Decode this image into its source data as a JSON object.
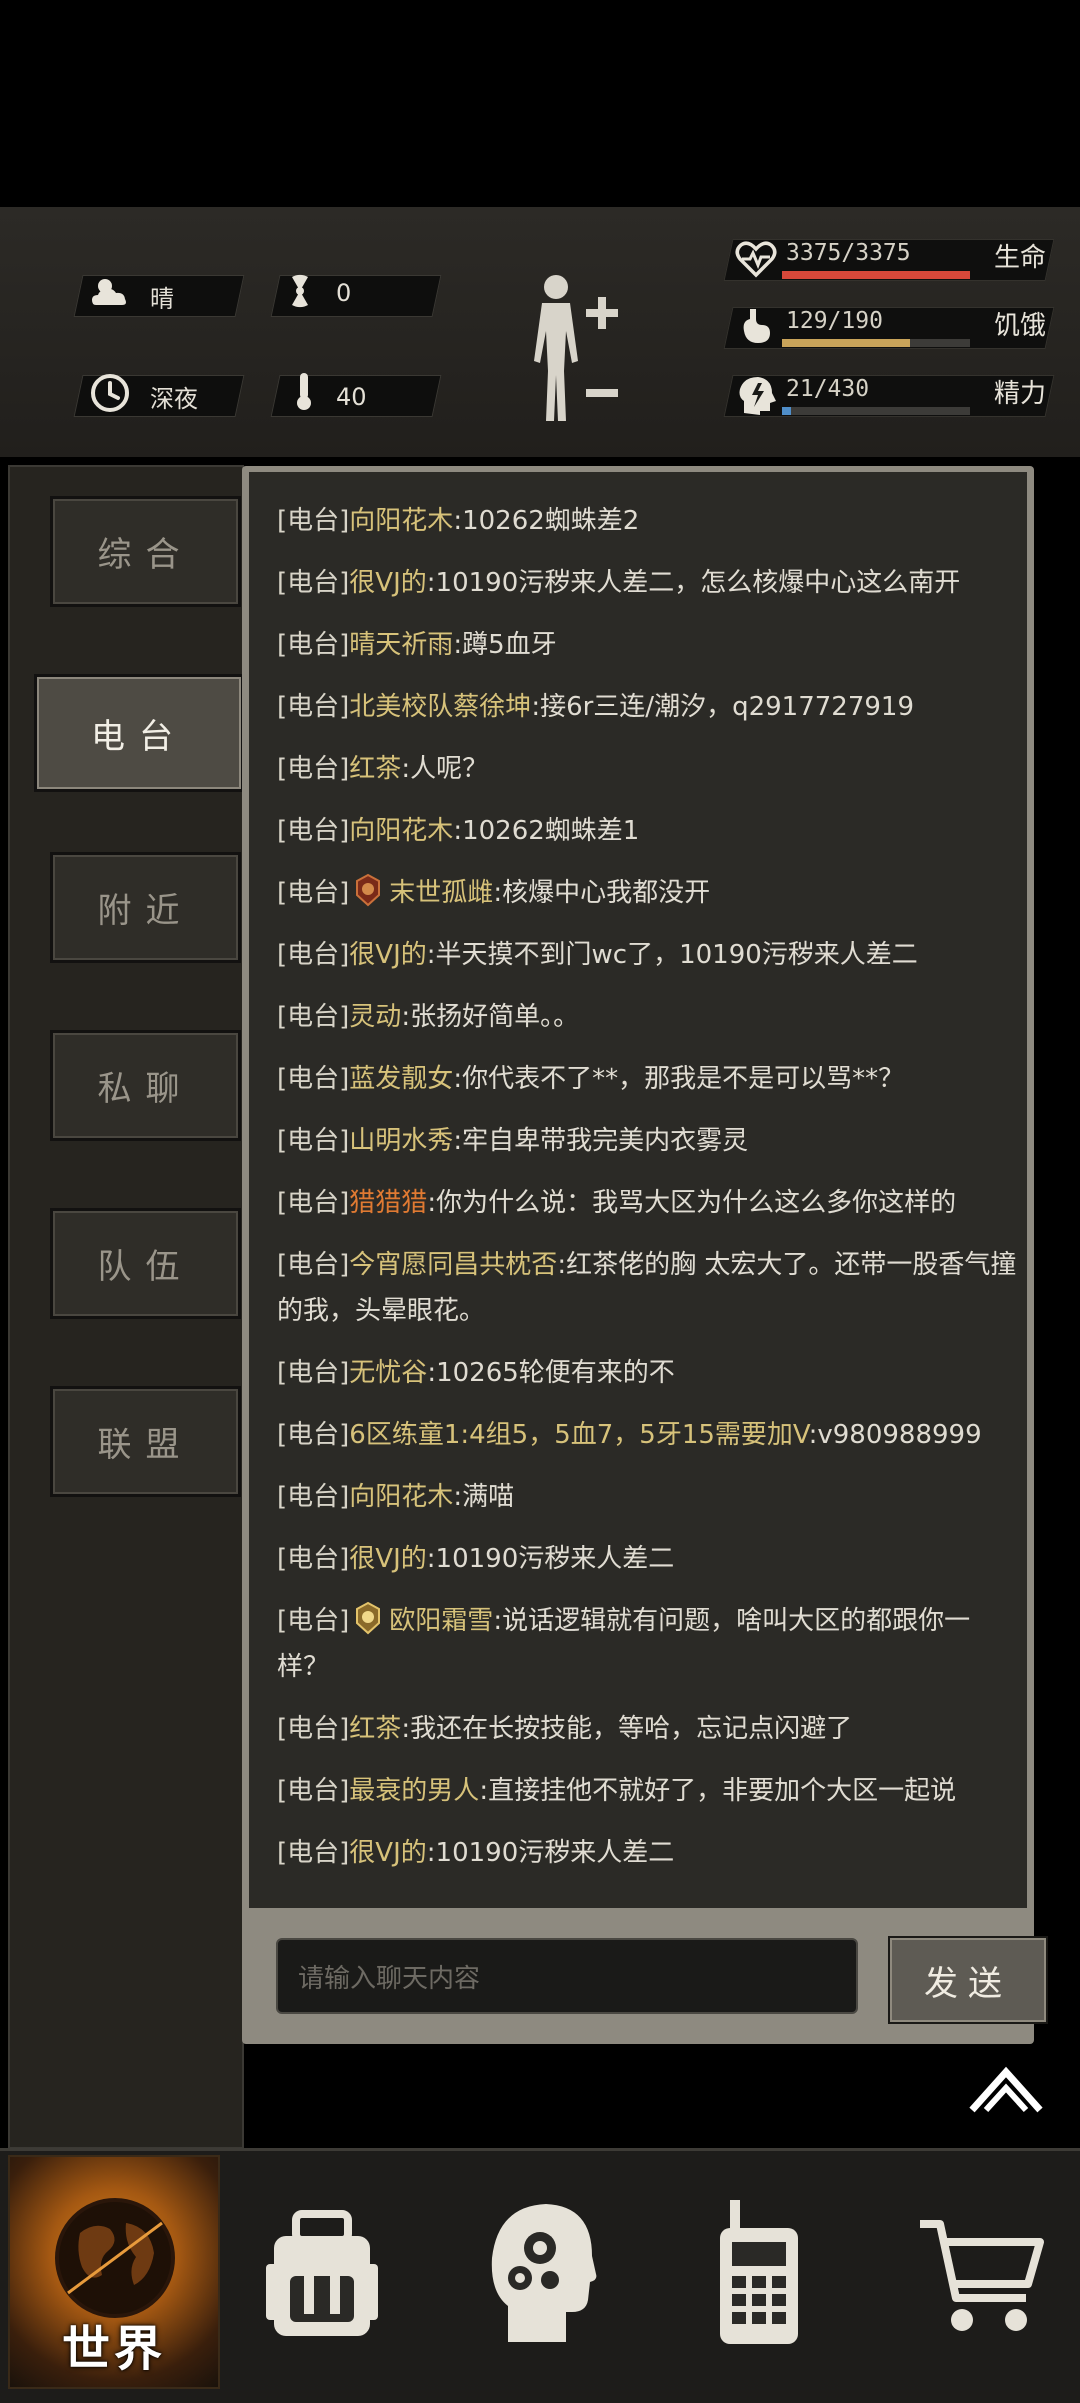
{
  "status": {
    "weather": "晴",
    "radiation": "0",
    "time_of_day": "深夜",
    "temperature": "40",
    "health": {
      "text": "3375/3375",
      "label": "生命",
      "fill": 1.0,
      "color": "#d9483a"
    },
    "hunger": {
      "text": "129/190",
      "label": "饥饿",
      "fill": 0.68,
      "color": "#c9a45a"
    },
    "energy": {
      "text": "21/430",
      "label": "精力",
      "fill": 0.05,
      "color": "#4f8ec9"
    }
  },
  "tabs": [
    {
      "label": "综合",
      "active": false
    },
    {
      "label": "电台",
      "active": true
    },
    {
      "label": "附近",
      "active": false
    },
    {
      "label": "私聊",
      "active": false
    },
    {
      "label": "队伍",
      "active": false
    },
    {
      "label": "联盟",
      "active": false
    }
  ],
  "chat": {
    "messages": [
      {
        "channel": "[电台]",
        "nick": "向阳花木",
        "text": ":10262蜘蛛差2"
      },
      {
        "channel": "[电台]",
        "nick": "很VJ的",
        "text": ":10190污秽来人差二，怎么核爆中心这么南开"
      },
      {
        "channel": "[电台]",
        "nick": "晴天祈雨",
        "text": ":蹲5血牙"
      },
      {
        "channel": "[电台]",
        "nick": "北美校队蔡徐坤",
        "text": ":接6r三连/潮汐，q2917727919"
      },
      {
        "channel": "[电台]",
        "nick": "红茶",
        "text": ":人呢？"
      },
      {
        "channel": "[电台]",
        "nick": "向阳花木",
        "text": ":10262蜘蛛差1"
      },
      {
        "channel": "[电台]",
        "nick": "末世孤雌",
        "text": ":核爆中心我都没开",
        "badge": "red"
      },
      {
        "channel": "[电台]",
        "nick": "很VJ的",
        "text": ":半天摸不到门wc了，10190污秽来人差二"
      },
      {
        "channel": "[电台]",
        "nick": "灵动",
        "text": ":张扬好简单。。"
      },
      {
        "channel": "[电台]",
        "nick": "蓝发靓女",
        "text": ":你代表不了**，那我是不是可以骂**？"
      },
      {
        "channel": "[电台]",
        "nick": "山明水秀",
        "text": ":牢自卑带我完美内衣雾灵"
      },
      {
        "channel": "[电台]",
        "nick": "猎猎猎",
        "text": ":你为什么说：我骂大区为什么这么多你这样的",
        "orange": true
      },
      {
        "channel": "[电台]",
        "nick": "今宵愿同昌共枕否",
        "text": ":红茶佬的胸 太宏大了。还带一股香气撞的我，头晕眼花。"
      },
      {
        "channel": "[电台]",
        "nick": "无忧谷",
        "text": ":10265轮便有来的不"
      },
      {
        "channel": "[电台]",
        "nick": "6区练童1:4组5，5血7，5牙15需要加V",
        "text": ":v980988999"
      },
      {
        "channel": "[电台]",
        "nick": "向阳花木",
        "text": ":满喵"
      },
      {
        "channel": "[电台]",
        "nick": "很VJ的",
        "text": ":10190污秽来人差二"
      },
      {
        "channel": "[电台]",
        "nick": "欧阳霜雪",
        "text": ":说话逻辑就有问题，啥叫大区的都跟你一样？",
        "badge": "gold"
      },
      {
        "channel": "[电台]",
        "nick": "红茶",
        "text": ":我还在长按技能，等哈，忘记点闪避了"
      },
      {
        "channel": "[电台]",
        "nick": "最衰的男人",
        "text": ":直接挂他不就好了，非要加个大区一起说"
      },
      {
        "channel": "[电台]",
        "nick": "很VJ的",
        "text": ":10190污秽来人差二"
      }
    ],
    "input_placeholder": "请输入聊天内容",
    "send_label": "发送"
  },
  "nav": {
    "world_label": "世界",
    "items": [
      "world-icon",
      "backpack-icon",
      "brain-skills-icon",
      "radio-icon",
      "shopping-cart-icon"
    ]
  }
}
